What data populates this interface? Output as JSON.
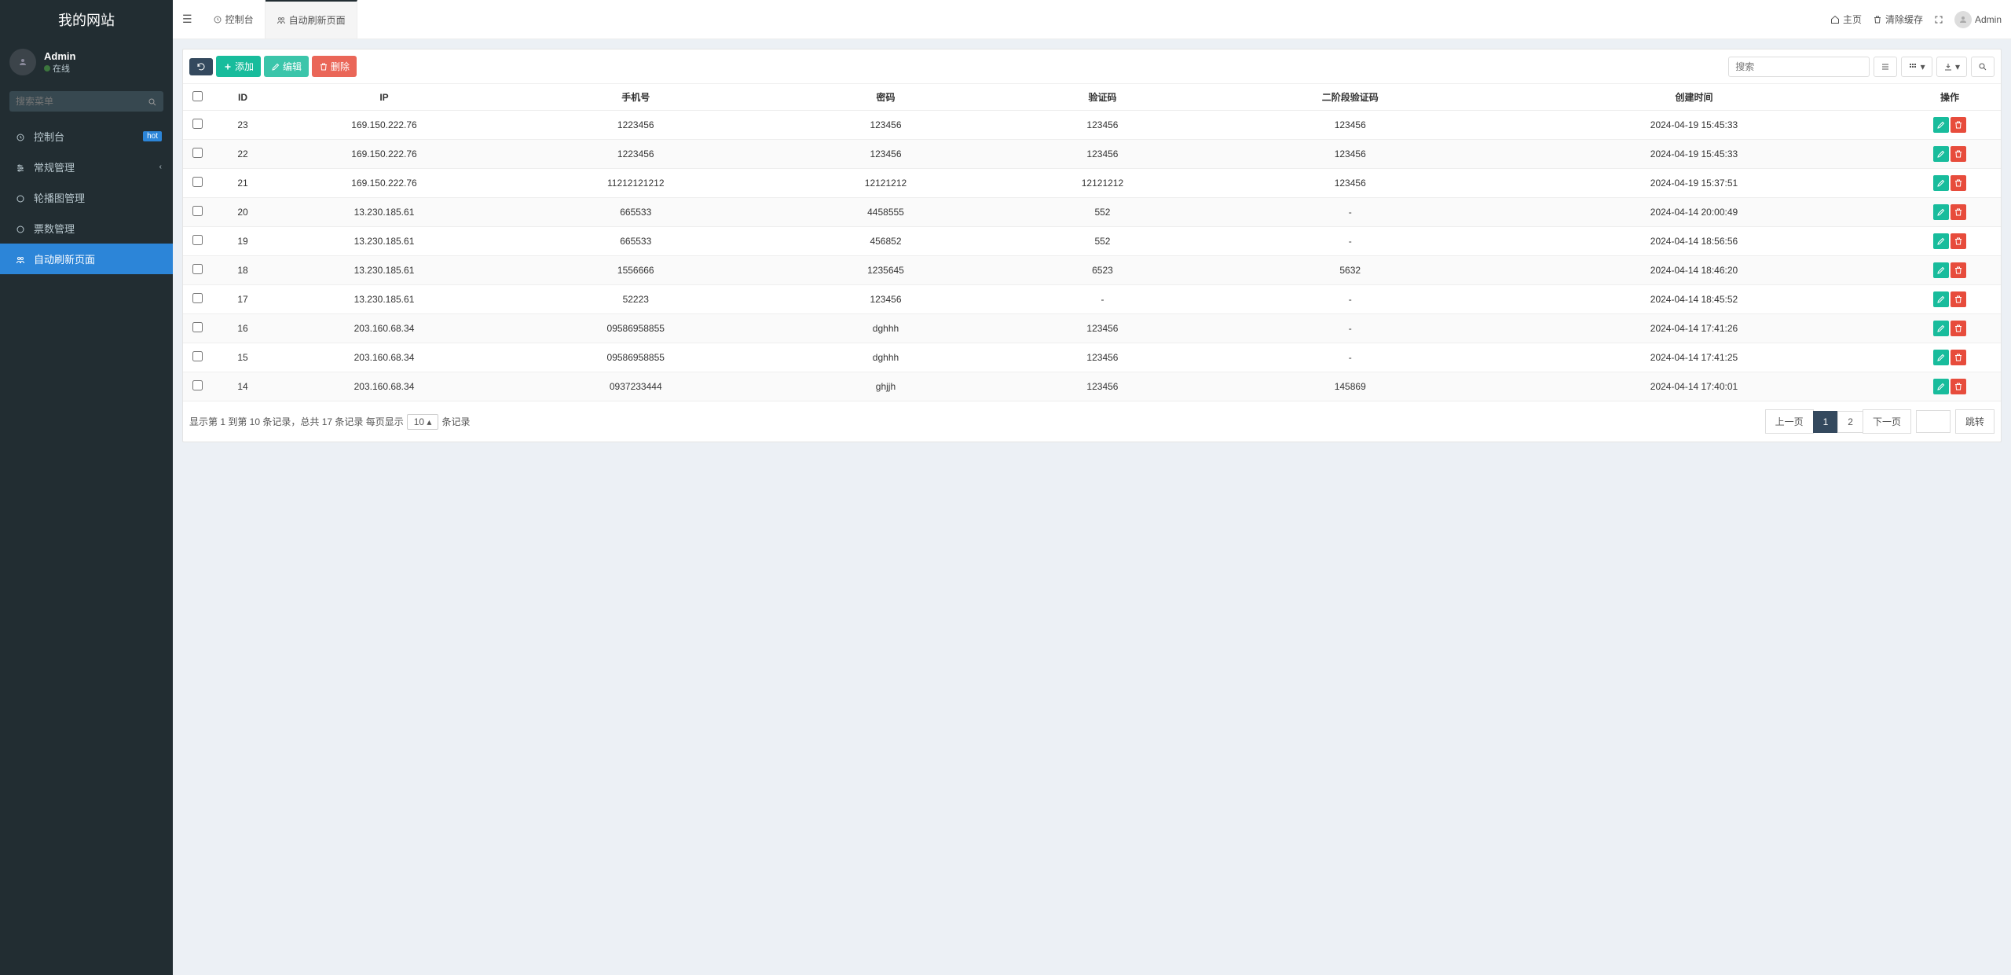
{
  "brand": "我的网站",
  "user": {
    "name": "Admin",
    "status": "在线"
  },
  "searchMenuPlaceholder": "搜索菜单",
  "sidebar": {
    "items": [
      {
        "label": "控制台",
        "badge": "hot"
      },
      {
        "label": "常规管理",
        "hasCaret": true
      },
      {
        "label": "轮播图管理"
      },
      {
        "label": "票数管理"
      },
      {
        "label": "自动刷新页面",
        "active": true
      }
    ]
  },
  "tabs": [
    {
      "label": "控制台"
    },
    {
      "label": "自动刷新页面",
      "active": true
    }
  ],
  "topbarRight": {
    "home": "主页",
    "clearCache": "清除缓存",
    "admin": "Admin"
  },
  "toolbar": {
    "add": "添加",
    "edit": "编辑",
    "delete": "删除",
    "searchPlaceholder": "搜索"
  },
  "columns": [
    "",
    "ID",
    "IP",
    "手机号",
    "密码",
    "验证码",
    "二阶段验证码",
    "创建时间",
    "操作"
  ],
  "rows": [
    {
      "id": "23",
      "ip": "169.150.222.76",
      "phone": "1223456",
      "pwd": "123456",
      "code": "123456",
      "code2": "123456",
      "time": "2024-04-19 15:45:33"
    },
    {
      "id": "22",
      "ip": "169.150.222.76",
      "phone": "1223456",
      "pwd": "123456",
      "code": "123456",
      "code2": "123456",
      "time": "2024-04-19 15:45:33"
    },
    {
      "id": "21",
      "ip": "169.150.222.76",
      "phone": "11212121212",
      "pwd": "12121212",
      "code": "12121212",
      "code2": "123456",
      "time": "2024-04-19 15:37:51"
    },
    {
      "id": "20",
      "ip": "13.230.185.61",
      "phone": "665533",
      "pwd": "4458555",
      "code": "552",
      "code2": "-",
      "time": "2024-04-14 20:00:49"
    },
    {
      "id": "19",
      "ip": "13.230.185.61",
      "phone": "665533",
      "pwd": "456852",
      "code": "552",
      "code2": "-",
      "time": "2024-04-14 18:56:56"
    },
    {
      "id": "18",
      "ip": "13.230.185.61",
      "phone": "1556666",
      "pwd": "1235645",
      "code": "6523",
      "code2": "5632",
      "time": "2024-04-14 18:46:20"
    },
    {
      "id": "17",
      "ip": "13.230.185.61",
      "phone": "52223",
      "pwd": "123456",
      "code": "-",
      "code2": "-",
      "time": "2024-04-14 18:45:52"
    },
    {
      "id": "16",
      "ip": "203.160.68.34",
      "phone": "09586958855",
      "pwd": "dghhh",
      "code": "123456",
      "code2": "-",
      "time": "2024-04-14 17:41:26"
    },
    {
      "id": "15",
      "ip": "203.160.68.34",
      "phone": "09586958855",
      "pwd": "dghhh",
      "code": "123456",
      "code2": "-",
      "time": "2024-04-14 17:41:25"
    },
    {
      "id": "14",
      "ip": "203.160.68.34",
      "phone": "0937233444",
      "pwd": "ghjjh",
      "code": "123456",
      "code2": "145869",
      "time": "2024-04-14 17:40:01"
    }
  ],
  "pagination": {
    "infoPrefix": "显示第 1 到第 10 条记录，总共 17 条记录 每页显示",
    "perPage": "10",
    "infoSuffix": "条记录",
    "prev": "上一页",
    "pages": [
      "1",
      "2"
    ],
    "current": "1",
    "next": "下一页",
    "jump": "跳转"
  }
}
